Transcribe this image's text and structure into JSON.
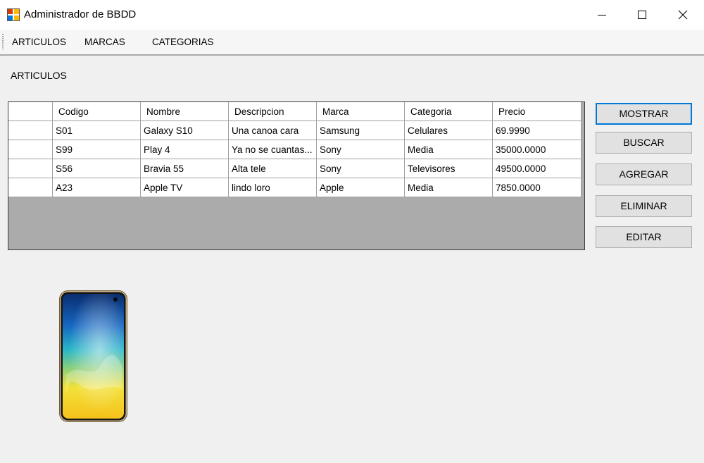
{
  "window": {
    "title": "Administrador de BBDD",
    "icons": [
      "app-database-icon",
      "minimize-icon",
      "maximize-icon",
      "close-icon"
    ]
  },
  "menu": {
    "items": [
      {
        "label": "ARTICULOS"
      },
      {
        "label": "MARCAS"
      },
      {
        "label": "CATEGORIAS"
      }
    ]
  },
  "main": {
    "section_label": "ARTICULOS",
    "grid": {
      "columns": [
        "Codigo",
        "Nombre",
        "Descripcion",
        "Marca",
        "Categoria",
        "Precio"
      ],
      "rows": [
        [
          "S01",
          "Galaxy S10",
          "Una canoa cara",
          "Samsung",
          "Celulares",
          "69.9990"
        ],
        [
          "S99",
          "Play 4",
          "Ya no se cuantas...",
          "Sony",
          "Media",
          "35000.0000"
        ],
        [
          "S56",
          "Bravia 55",
          "Alta tele",
          "Sony",
          "Televisores",
          "49500.0000"
        ],
        [
          "A23",
          "Apple TV",
          "lindo loro",
          "Apple",
          "Media",
          "7850.0000"
        ]
      ]
    },
    "buttons": {
      "mostrar": "MOSTRAR",
      "buscar": "BUSCAR",
      "agregar": "AGREGAR",
      "eliminar": "ELIMINAR",
      "editar": "EDITAR"
    },
    "preview_image": "smartphone-image",
    "colors": {
      "accent": "#0078d7",
      "grid_background": "#ababab",
      "button_face": "#e1e1e1"
    }
  }
}
